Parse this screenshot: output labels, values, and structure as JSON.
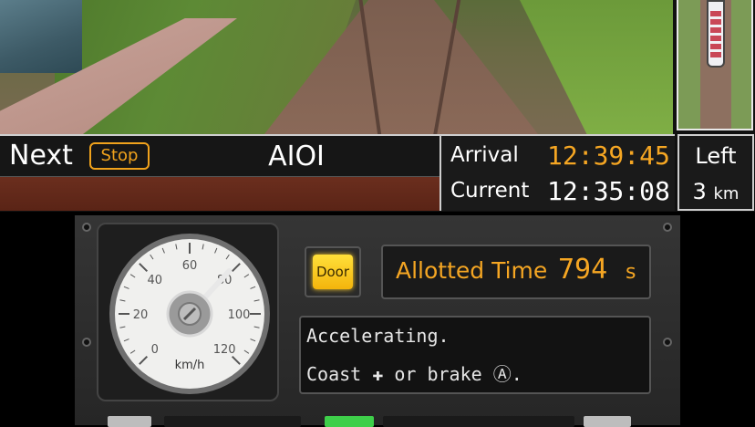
{
  "top_screen": {
    "next_label": "Next",
    "stop_badge": "Stop",
    "station": "AIOI",
    "arrival_label": "Arrival",
    "arrival_time": "12:39:45",
    "current_label": "Current",
    "current_time": "12:35:08",
    "left_label": "Left",
    "left_value": "3",
    "left_unit": "km"
  },
  "bottom_screen": {
    "door_label": "Door",
    "allotted_label": "Allotted Time",
    "allotted_value": "794",
    "allotted_unit": "s",
    "message_line1": "Accelerating.",
    "message_line2": "Coast ✚ or brake Ⓐ.",
    "speedometer": {
      "unit": "km/h",
      "ticks": [
        "0",
        "20",
        "40",
        "60",
        "80",
        "100",
        "120"
      ],
      "max": 120,
      "current_speed": 79
    }
  },
  "colors": {
    "accent_orange": "#f5a623",
    "door_yellow": "#ffd21f",
    "info_bg": "#161616"
  }
}
